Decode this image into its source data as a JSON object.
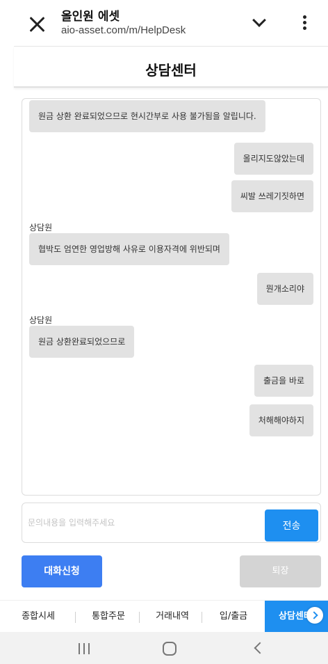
{
  "browser": {
    "site_name": "올인원 에셋",
    "url": "aio-asset.com/m/HelpDesk"
  },
  "header": {
    "title": "상담센터"
  },
  "chat": {
    "messages": [
      {
        "sender": "",
        "text": "원금 상환 완료되었으므로 현시간부로 사용 불가됨을 알립니다.",
        "side": "left"
      },
      {
        "sender": "",
        "text": "올리지도않았는데",
        "side": "right"
      },
      {
        "sender": "",
        "text": "씨발 쓰레기짓하면",
        "side": "right"
      },
      {
        "sender": "상담원",
        "text": "협박도 엄연한 영업방해 사유로 이용자격에 위반되며",
        "side": "left"
      },
      {
        "sender": "",
        "text": "뭔개소리야",
        "side": "right"
      },
      {
        "sender": "상담원",
        "text": "원금 상환완료되었으므로",
        "side": "left"
      },
      {
        "sender": "",
        "text": "출금을 바로",
        "side": "right"
      },
      {
        "sender": "",
        "text": "처해해야하지",
        "side": "right"
      }
    ]
  },
  "input": {
    "placeholder": "문의내용을 입력해주세요",
    "value": "",
    "send_label": "전송"
  },
  "actions": {
    "request_label": "대화신청",
    "exit_label": "퇴장"
  },
  "bottom_nav": {
    "items": [
      {
        "label": "종합시세"
      },
      {
        "label": "통합주문"
      },
      {
        "label": "거래내역"
      },
      {
        "label": "입/출금"
      },
      {
        "label": "상담센터"
      }
    ],
    "active_index": 4
  },
  "colors": {
    "accent": "#1e8ff0",
    "request_button": "#3d7ef2",
    "exit_button": "#d4d4d4",
    "bubble": "#e2e2e2"
  }
}
